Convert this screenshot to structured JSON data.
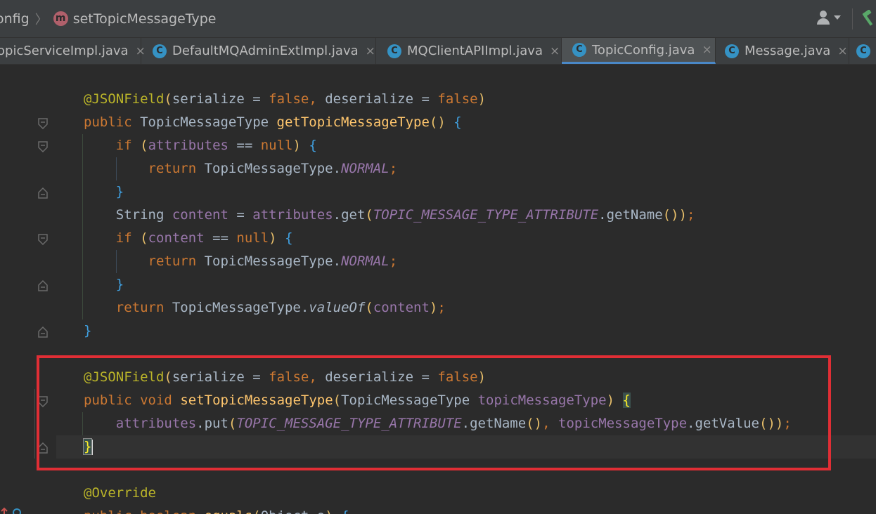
{
  "breadcrumb": {
    "parent": "onfig",
    "method_icon": "m",
    "method": "setTopicMessageType"
  },
  "tabs": [
    {
      "label": "opicServiceImpl.java",
      "icon": "c-icon",
      "active": false
    },
    {
      "label": "DefaultMQAdminExtImpl.java",
      "icon": "c-icon",
      "active": false
    },
    {
      "label": "MQClientAPIImpl.java",
      "icon": "c-icon",
      "active": false
    },
    {
      "label": "TopicConfig.java",
      "icon": "c-icon",
      "active": true
    },
    {
      "label": "Message.java",
      "icon": "c-icon",
      "active": false
    }
  ],
  "tab_close_glyph": "×",
  "code_lines": [
    "@JSONField(serialize = false, deserialize = false)",
    "public TopicMessageType getTopicMessageType() {",
    "    if (attributes == null) {",
    "        return TopicMessageType.NORMAL;",
    "    }",
    "    String content = attributes.get(TOPIC_MESSAGE_TYPE_ATTRIBUTE.getName());",
    "    if (content == null) {",
    "        return TopicMessageType.NORMAL;",
    "    }",
    "    return TopicMessageType.valueOf(content);",
    "}",
    "",
    "@JSONField(serialize = false, deserialize = false)",
    "public void setTopicMessageType(TopicMessageType topicMessageType) {",
    "    attributes.put(TOPIC_MESSAGE_TYPE_ATTRIBUTE.getName(), topicMessageType.getValue());",
    "}",
    "",
    "@Override",
    "public boolean equals(Object o) {"
  ],
  "colors": {
    "editor_bg": "#2b2b2b",
    "keyword": "#cc7832",
    "annotation": "#bbb529",
    "field": "#9876aa",
    "method": "#ffc66d",
    "highlight_box": "#e02e35",
    "active_tab_underline": "#4a88c7"
  },
  "icons": [
    "method-icon",
    "class-icon",
    "user-icon",
    "hammer-icon",
    "fold-icon"
  ]
}
